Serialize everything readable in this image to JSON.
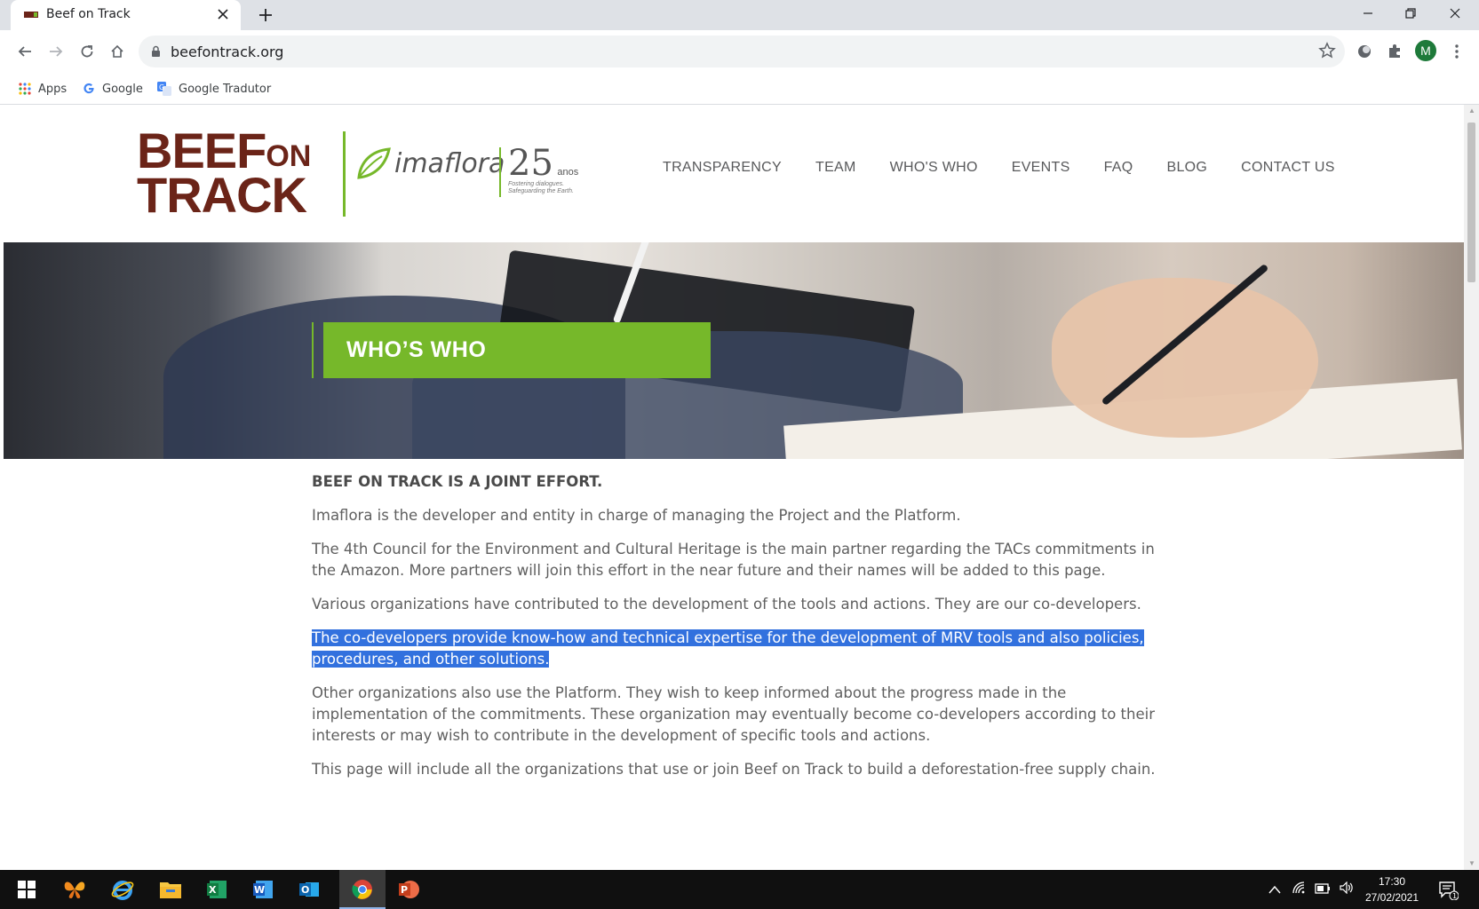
{
  "browser": {
    "tab_title": "Beef on Track",
    "url": "beefontrack.org",
    "bookmarks": [
      {
        "label": "Apps",
        "icon": "apps-grid-icon"
      },
      {
        "label": "Google",
        "icon": "google-icon"
      },
      {
        "label": "Google Tradutor",
        "icon": "google-translate-icon"
      }
    ],
    "profile_initial": "M"
  },
  "site": {
    "logo": {
      "beef": "BEEF",
      "on": "ON",
      "track": "TRACK",
      "partner": "imaflora",
      "anniversary": "25",
      "anniversary_unit": "anos",
      "tagline_1": "Fostering dialogues.",
      "tagline_2": "Safeguarding the Earth."
    },
    "nav": [
      "TRANSPARENCY",
      "TEAM",
      "WHO'S WHO",
      "EVENTS",
      "FAQ",
      "BLOG",
      "CONTACT US"
    ],
    "hero_title": "WHO’S WHO",
    "heading": "BEEF ON TRACK IS A JOINT EFFORT.",
    "paragraphs": [
      "Imaflora is the developer and entity in charge of managing the Project and the Platform.",
      "The 4th Council for the Environment and Cultural Heritage is the main partner regarding the TACs commitments in the Amazon. More partners will join this effort in the near future and their names will be added to this page.",
      "Various organizations have contributed to the development of the tools and actions. They are our co-developers.",
      "The co-developers provide know-how and technical expertise for the development of MRV tools and also policies, procedures, and other solutions.",
      "Other organizations also use the Platform. They wish to keep informed about the progress made in the implementation of the commitments. These organization may eventually become co-developers according to their interests or may wish to contribute in the development of specific tools and actions.",
      "This page will include all the organizations that use or join Beef on Track to build a deforestation-free supply chain."
    ]
  },
  "taskbar": {
    "time": "17:30",
    "date": "27/02/2021",
    "notification_count": "1"
  },
  "colors": {
    "brand_brown": "#6b2418",
    "brand_green": "#76b82a",
    "selection": "#3271de"
  }
}
